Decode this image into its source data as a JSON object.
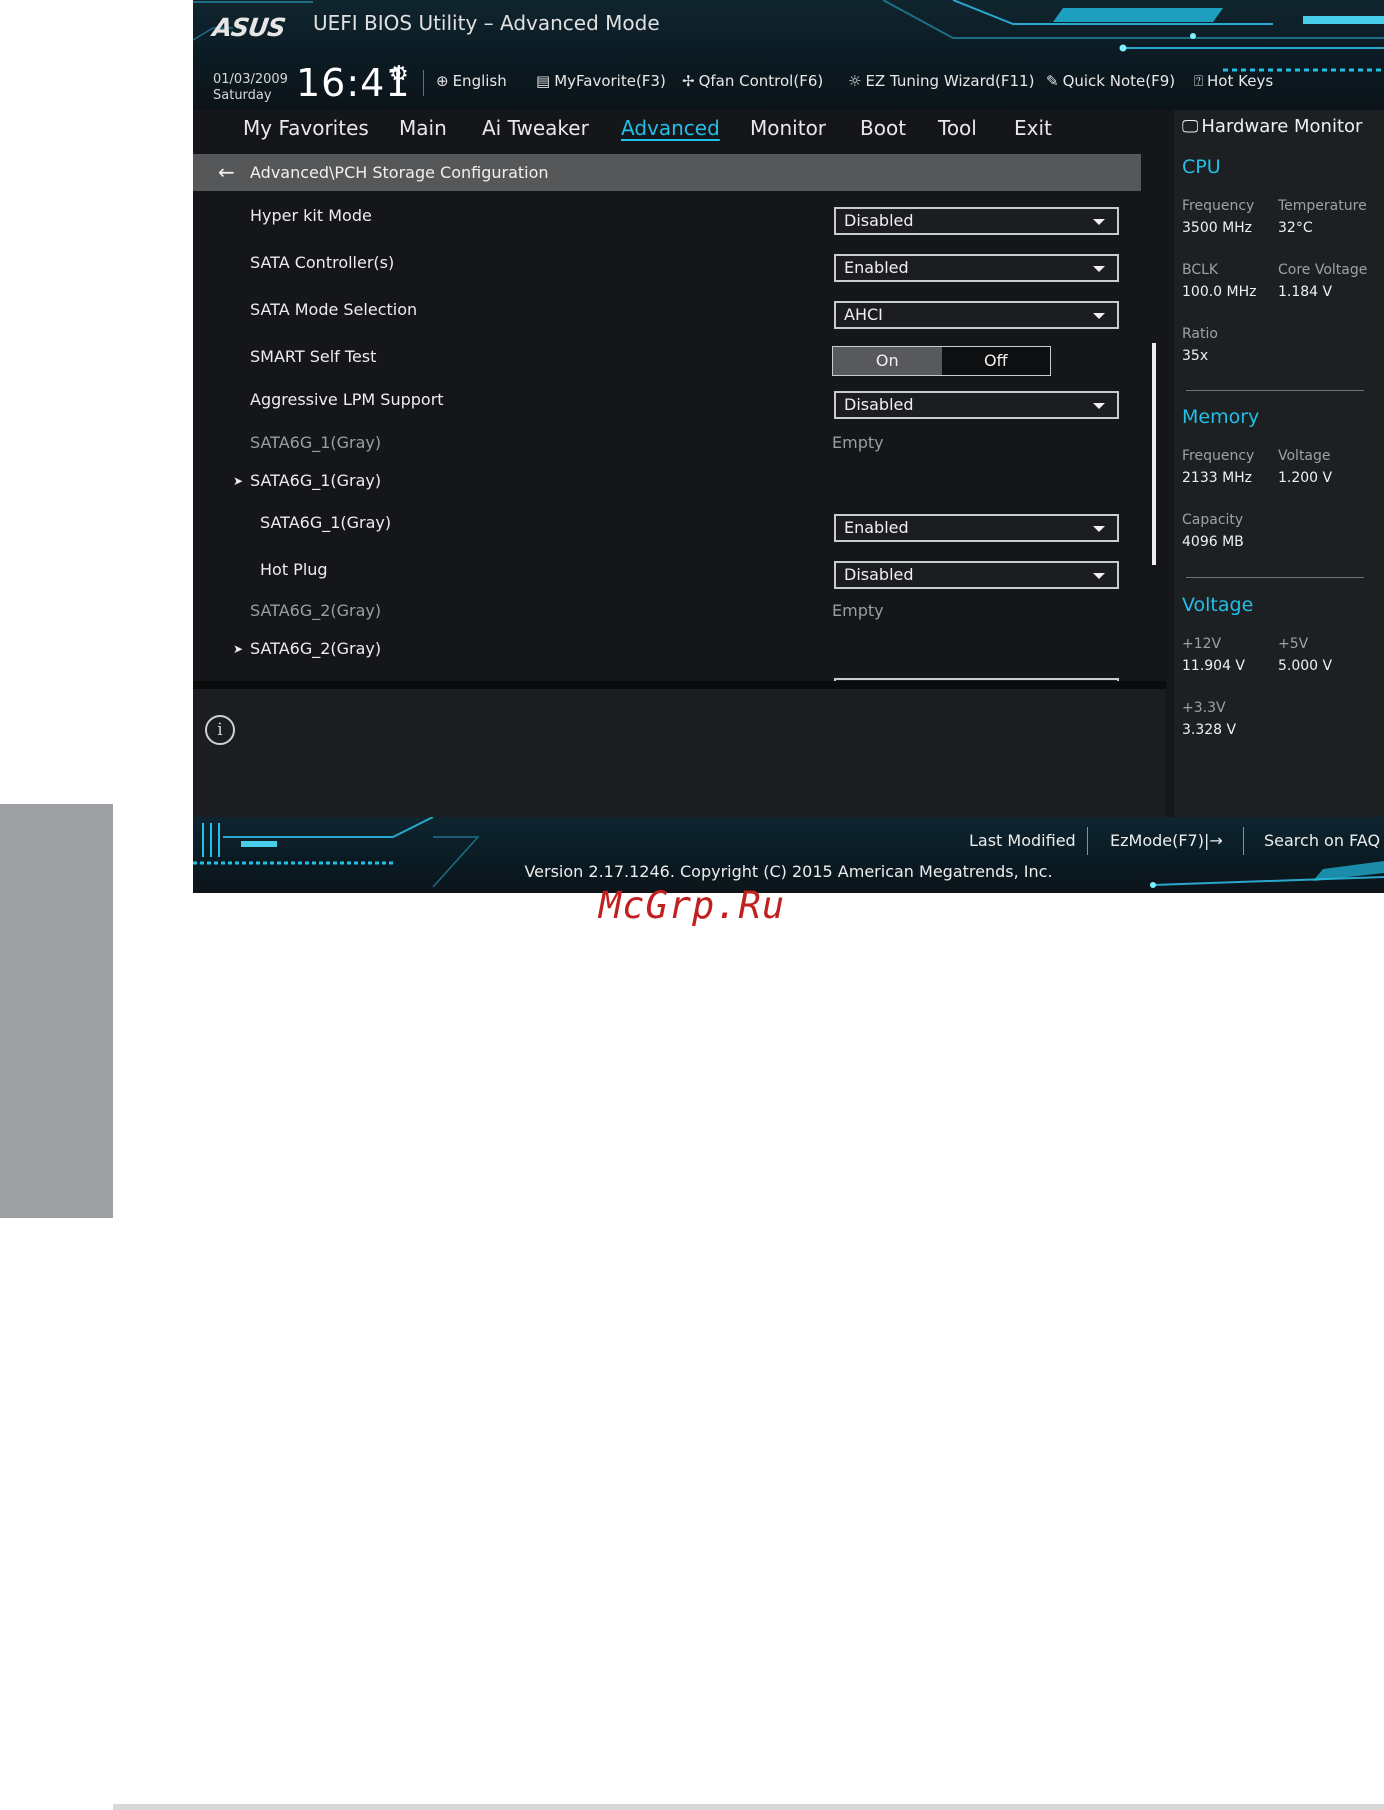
{
  "watermark": "McGrp.Ru",
  "header": {
    "logo": "ASUS",
    "title": "UEFI BIOS Utility – Advanced Mode",
    "date": "01/03/2009",
    "day": "Saturday",
    "time": "16:41",
    "tools": [
      {
        "icon": "globe-icon",
        "label": "English"
      },
      {
        "icon": "favorite-list-icon",
        "label": "MyFavorite(F3)"
      },
      {
        "icon": "fan-icon",
        "label": "Qfan Control(F6)"
      },
      {
        "icon": "lightbulb-icon",
        "label": "EZ Tuning Wizard(F11)"
      },
      {
        "icon": "note-icon",
        "label": "Quick Note(F9)"
      },
      {
        "icon": "question-icon",
        "label": "Hot Keys"
      }
    ]
  },
  "tabs": [
    {
      "label": "My Favorites",
      "active": false
    },
    {
      "label": "Main",
      "active": false
    },
    {
      "label": "Ai Tweaker",
      "active": false
    },
    {
      "label": "Advanced",
      "active": true
    },
    {
      "label": "Monitor",
      "active": false
    },
    {
      "label": "Boot",
      "active": false
    },
    {
      "label": "Tool",
      "active": false
    },
    {
      "label": "Exit",
      "active": false
    }
  ],
  "breadcrumb": "Advanced\\PCH Storage Configuration",
  "settings": [
    {
      "label": "Hyper kit Mode",
      "control": "dropdown",
      "value": "Disabled"
    },
    {
      "label": "SATA Controller(s)",
      "control": "dropdown",
      "value": "Enabled"
    },
    {
      "label": "SATA Mode Selection",
      "control": "dropdown",
      "value": "AHCI"
    },
    {
      "label": "SMART Self Test",
      "control": "toggle",
      "on_label": "On",
      "off_label": "Off",
      "value": "On"
    },
    {
      "label": "Aggressive LPM Support",
      "control": "dropdown",
      "value": "Disabled"
    },
    {
      "label": "SATA6G_1(Gray)",
      "control": "text",
      "value": "Empty"
    },
    {
      "label": "SATA6G_1(Gray)",
      "control": "submenu"
    },
    {
      "label": "SATA6G_1(Gray)",
      "control": "dropdown",
      "value": "Enabled"
    },
    {
      "label": "Hot Plug",
      "control": "dropdown",
      "value": "Disabled"
    },
    {
      "label": "SATA6G_2(Gray)",
      "control": "text",
      "value": "Empty"
    },
    {
      "label": "SATA6G_2(Gray)",
      "control": "submenu"
    }
  ],
  "hardware_monitor": {
    "title": "Hardware Monitor",
    "cpu": {
      "heading": "CPU",
      "frequency_label": "Frequency",
      "frequency": "3500 MHz",
      "temperature_label": "Temperature",
      "temperature": "32°C",
      "bclk_label": "BCLK",
      "bclk": "100.0 MHz",
      "core_voltage_label": "Core Voltage",
      "core_voltage": "1.184 V",
      "ratio_label": "Ratio",
      "ratio": "35x"
    },
    "memory": {
      "heading": "Memory",
      "frequency_label": "Frequency",
      "frequency": "2133 MHz",
      "voltage_label": "Voltage",
      "voltage": "1.200 V",
      "capacity_label": "Capacity",
      "capacity": "4096 MB"
    },
    "voltage": {
      "heading": "Voltage",
      "v12_label": "+12V",
      "v12": "11.904 V",
      "v5_label": "+5V",
      "v5": "5.000 V",
      "v33_label": "+3.3V",
      "v33": "3.328 V"
    }
  },
  "footer": {
    "last_modified": "Last Modified",
    "ezmode": "EzMode(F7)|",
    "search_faq": "Search on FAQ",
    "copyright": "Version 2.17.1246. Copyright (C) 2015 American Megatrends, Inc."
  },
  "colors": {
    "accent": "#22bfe6",
    "background": "#141619",
    "side_tab": "#9fa0a3"
  }
}
